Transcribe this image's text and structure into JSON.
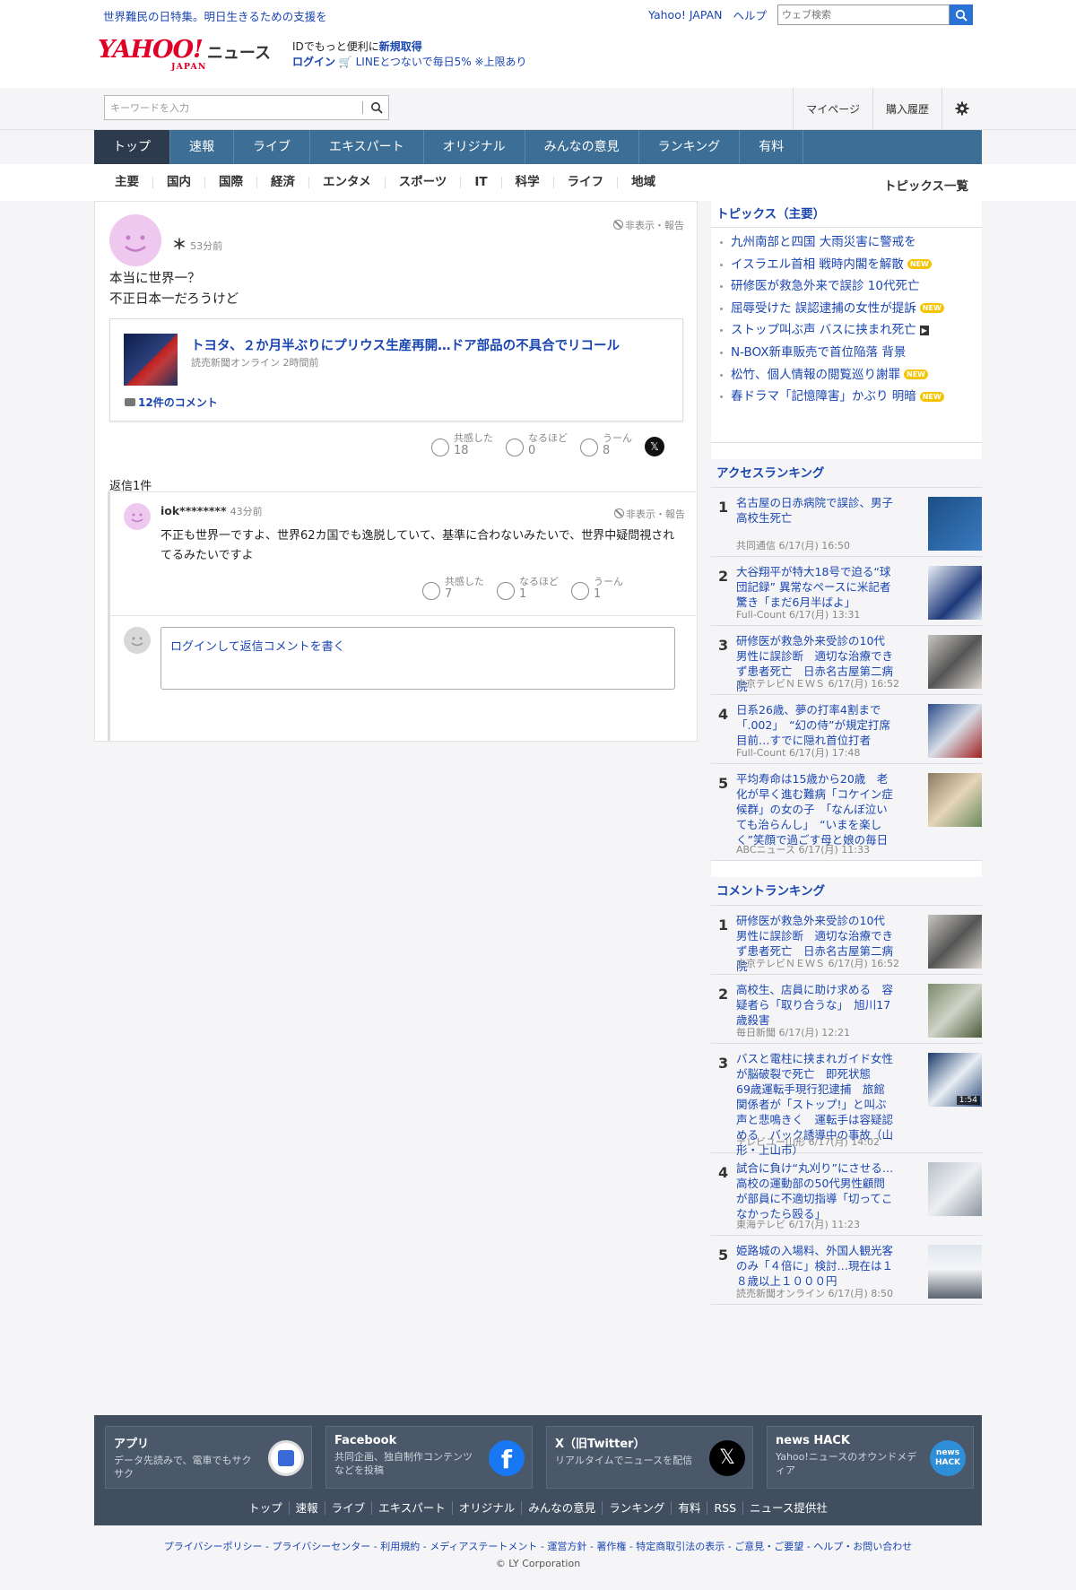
{
  "topbar": {
    "promo": "世界難民の日特集。明日生きるための支援を",
    "links": [
      "Yahoo! JAPAN",
      "ヘルプ"
    ],
    "search_placeholder": "ウェブ検索"
  },
  "header": {
    "logo_text": "YAHOO!",
    "logo_sub": "JAPAN",
    "section": "ニュース",
    "line1_prefix": "IDでもっと便利に",
    "line1_link": "新規取得",
    "login": "ログイン",
    "line2": "LINEとつないで毎日5% ※上限あり"
  },
  "search": {
    "placeholder": "キーワードを入力",
    "links": [
      "マイページ",
      "購入履歴"
    ]
  },
  "main_nav": [
    "トップ",
    "速報",
    "ライブ",
    "エキスパート",
    "オリジナル",
    "みんなの意見",
    "ランキング",
    "有料"
  ],
  "sub_nav": [
    "主要",
    "国内",
    "国際",
    "経済",
    "エンタメ",
    "スポーツ",
    "IT",
    "科学",
    "ライフ",
    "地域"
  ],
  "sub_nav_all": "トピックス一覧",
  "comment": {
    "user": "＊",
    "time": "53分前",
    "report": "非表示・報告",
    "text_1": "本当に世界一？",
    "text_2": "不正日本一だろうけど",
    "article": {
      "title": "トヨタ、２か月半ぶりにプリウス生産再開…ドア部品の不具合でリコール",
      "source": "読売新聞オンライン 2時間前",
      "comments": "12件のコメント"
    },
    "reactions": [
      {
        "label": "共感した",
        "count": "18"
      },
      {
        "label": "なるほど",
        "count": "0"
      },
      {
        "label": "うーん",
        "count": "8"
      }
    ],
    "replies_label": "返信1件"
  },
  "reply": {
    "user": "iok********",
    "time": "43分前",
    "report": "非表示・報告",
    "text": "不正も世界一ですよ、世界62カ国でも逸脱していて、基準に合わないみたいで、世界中疑問視されてるみたいですよ",
    "reactions": [
      {
        "label": "共感した",
        "count": "7"
      },
      {
        "label": "なるほど",
        "count": "1"
      },
      {
        "label": "うーん",
        "count": "1"
      }
    ],
    "login_prompt": "ログインして返信コメントを書く"
  },
  "topics": {
    "title": "トピックス（主要）",
    "items": [
      {
        "text": "九州南部と四国 大雨災害に警戒を",
        "badge": ""
      },
      {
        "text": "イスラエル首相 戦時内閣を解散",
        "badge": "NEW"
      },
      {
        "text": "研修医が救急外来で誤診 10代死亡",
        "badge": ""
      },
      {
        "text": "屈辱受けた 誤認逮捕の女性が提訴",
        "badge": "NEW"
      },
      {
        "text": "ストップ叫ぶ声 バスに挟まれ死亡",
        "badge": "▶"
      },
      {
        "text": "N-BOX新車販売で首位陥落 背景",
        "badge": ""
      },
      {
        "text": "松竹、個人情報の閲覧巡り謝罪",
        "badge": "NEW"
      },
      {
        "text": "春ドラマ「記憶障害」かぶり 明暗",
        "badge": "NEW"
      }
    ]
  },
  "access_ranking": {
    "title": "アクセスランキング",
    "items": [
      {
        "rank": "1",
        "title": "名古屋の日赤病院で誤診、男子高校生死亡",
        "meta": "共同通信 6/17(月) 16:50"
      },
      {
        "rank": "2",
        "title": "大谷翔平が特大18号で迫る“球団記録” 異常なペースに米記者驚き「まだ6月半ばよ」",
        "meta": "Full-Count 6/17(月) 13:31"
      },
      {
        "rank": "3",
        "title": "研修医が救急外来受診の10代男性に誤診断　適切な治療できず患者死亡　日赤名古屋第二病院",
        "meta": "中京テレビＮＥＷＳ 6/17(月) 16:52"
      },
      {
        "rank": "4",
        "title": "日系26歳、夢の打率4割まで「.002」　“幻の侍”が規定打席目前…すでに隠れ首位打者",
        "meta": "Full-Count 6/17(月) 17:48"
      },
      {
        "rank": "5",
        "title": "平均寿命は15歳から20歳　老化が早く進む難病「コケイン症候群」の女の子　「なんぼ泣いても治らんし」　“いまを楽しく”笑顔で過ごす母と娘の毎日",
        "meta": "ABCニュース 6/17(月) 11:33"
      }
    ]
  },
  "comment_ranking": {
    "title": "コメントランキング",
    "items": [
      {
        "rank": "1",
        "title": "研修医が救急外来受診の10代男性に誤診断　適切な治療できず患者死亡　日赤名古屋第二病院",
        "meta": "中京テレビＮＥＷＳ 6/17(月) 16:52"
      },
      {
        "rank": "2",
        "title": "高校生、店員に助け求める　容疑者ら「取り合うな」　旭川17歳殺害",
        "meta": "毎日新聞 6/17(月) 12:21"
      },
      {
        "rank": "3",
        "title": "バスと電柱に挟まれガイド女性が脳破裂で死亡　即死状態　69歳運転手現行犯逮捕　旅館関係者が「ストップ!」と叫ぶ声と悲鳴きく　運転手は容疑認める　バック誘導中の事故（山形・上山市）",
        "meta": "テレビユー山形 6/17(月) 14:02",
        "badge": "1:54"
      },
      {
        "rank": "4",
        "title": "試合に負け“丸刈り”にさせる…高校の運動部の50代男性顧問が部員に不適切指導「切ってこなかったら殴る」",
        "meta": "東海テレビ 6/17(月) 11:23"
      },
      {
        "rank": "5",
        "title": "姫路城の入場料、外国人観光客のみ「４倍に」検討…現在は１８歳以上１０００円",
        "meta": "読売新聞オンライン 6/17(月) 8:50"
      }
    ]
  },
  "footer": {
    "cards": [
      {
        "title": "アプリ",
        "desc": "データ先読みで、電車でもサクサク"
      },
      {
        "title": "Facebook",
        "desc": "共同企画、独自制作コンテンツなどを投稿"
      },
      {
        "title": "X（旧Twitter）",
        "desc": "リアルタイムでニュースを配信"
      },
      {
        "title": "news HACK",
        "desc": "Yahoo!ニュースのオウンドメディア"
      }
    ],
    "links": [
      "トップ",
      "速報",
      "ライブ",
      "エキスパート",
      "オリジナル",
      "みんなの意見",
      "ランキング",
      "有料",
      "RSS",
      "ニュース提供社"
    ],
    "legal": "プライバシーポリシー - プライバシーセンター - 利用規約 - メディアステートメント - 運営方針 - 著作権 - 特定商取引法の表示 - ご意見・ご要望 - ヘルプ・お問い合わせ",
    "copyright": "© LY Corporation",
    "newshack_logo": "news HACK"
  },
  "colors": {
    "link": "#1a46b0",
    "nav": "#3c6e96",
    "nav_active": "#2e3b4e",
    "footer": "#404e5f",
    "brand_red": "#e00027"
  }
}
